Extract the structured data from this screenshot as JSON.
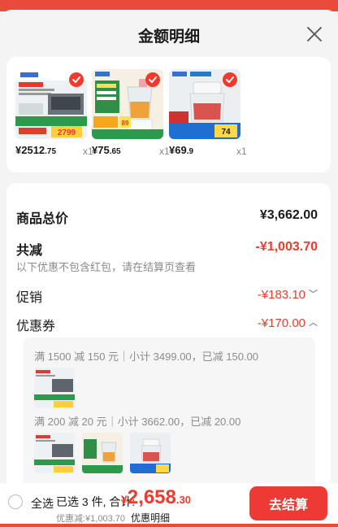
{
  "header": {
    "title": "金额明细"
  },
  "products": [
    {
      "name": "range-hood-product",
      "price_int": "¥2512",
      "price_dec": ".75",
      "qty": "x1",
      "thumb_tag": "2799"
    },
    {
      "name": "blender-product",
      "price_int": "¥75",
      "price_dec": ".65",
      "qty": "x1",
      "thumb_tag": "89"
    },
    {
      "name": "food-chopper-product",
      "price_int": "¥69",
      "price_dec": ".9",
      "qty": "x1",
      "thumb_tag": "74"
    }
  ],
  "summary": {
    "total_label": "商品总价",
    "total_value": "¥3,662.00",
    "reduce_label": "共减",
    "reduce_value": "-¥1,003.70",
    "note": "以下优惠不包含红包，请在结算页查看",
    "promo_label": "促销",
    "promo_value": "-¥183.10",
    "coupon_label": "优惠券",
    "coupon_value": "-¥170.00"
  },
  "coupons": [
    {
      "rule": "满 1500 减 150 元｜小计 3499.00，已减 150.00"
    },
    {
      "rule": "满 200 减 20 元｜小计 3662.00，已减 20.00"
    }
  ],
  "bottom_bar": {
    "select_all": "全选",
    "selected": "已选 3 件, 合计:",
    "currency": "¥",
    "total_int": "2,658",
    "total_dec": ".30",
    "discount": "优惠减:¥1,003.70",
    "detail_link": "优惠明细",
    "checkout": "去结算"
  },
  "colors": {
    "accent_red": "#f03a2d",
    "button_red": "#ee3a35"
  }
}
